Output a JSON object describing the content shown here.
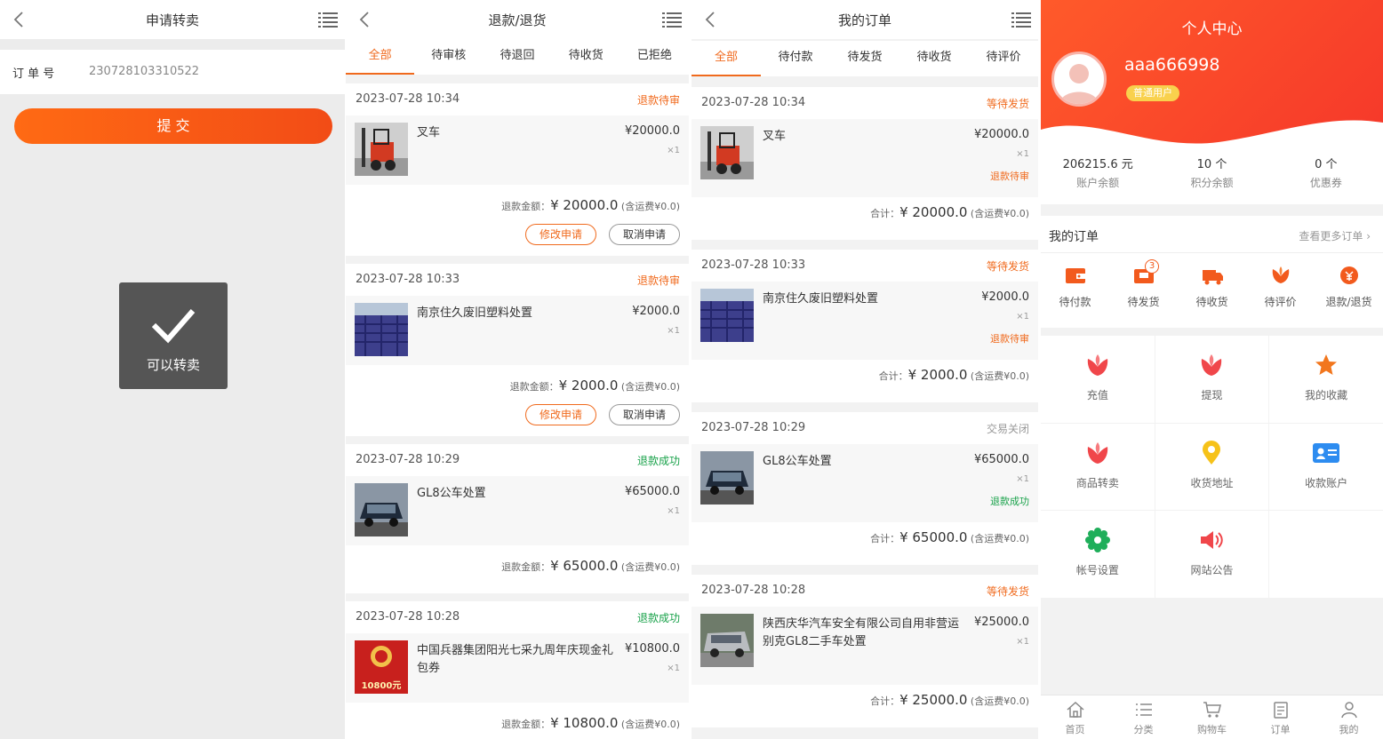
{
  "p1": {
    "title": "申请转卖",
    "order_label": "订 单 号",
    "order_no": "230728103310522",
    "submit": "提 交",
    "toast": "可以转卖"
  },
  "p2": {
    "title": "退款/退货",
    "tabs": [
      "全部",
      "待审核",
      "待退回",
      "待收货",
      "已拒绝"
    ],
    "cards": [
      {
        "date": "2023-07-28 10:34",
        "status": "退款待审",
        "name": "叉车",
        "price": "¥20000.0",
        "qty": "×1",
        "sum_label": "退款金额：",
        "sum": "¥ 20000.0",
        "freight": "(含运费¥0.0)",
        "btn1": "修改申请",
        "btn2": "取消申请"
      },
      {
        "date": "2023-07-28 10:33",
        "status": "退款待审",
        "name": "南京住久废旧塑料处置",
        "price": "¥2000.0",
        "qty": "×1",
        "sum_label": "退款金额：",
        "sum": "¥ 2000.0",
        "freight": "(含运费¥0.0)",
        "btn1": "修改申请",
        "btn2": "取消申请"
      },
      {
        "date": "2023-07-28 10:29",
        "status": "退款成功",
        "name": "GL8公车处置",
        "price": "¥65000.0",
        "qty": "×1",
        "sum_label": "退款金额：",
        "sum": "¥ 65000.0",
        "freight": "(含运费¥0.0)"
      },
      {
        "date": "2023-07-28 10:28",
        "status": "退款成功",
        "name": "中国兵器集团阳光七采九周年庆现金礼包券",
        "price": "¥10800.0",
        "qty": "×1",
        "sum_label": "退款金额：",
        "sum": "¥ 10800.0",
        "freight": "(含运费¥0.0)",
        "thumb_text": "10800元"
      }
    ]
  },
  "p3": {
    "title": "我的订单",
    "tabs": [
      "全部",
      "待付款",
      "待发货",
      "待收货",
      "待评价"
    ],
    "cards": [
      {
        "date": "2023-07-28 10:34",
        "status": "等待发货",
        "name": "叉车",
        "price": "¥20000.0",
        "qty": "×1",
        "sub": "退款待审",
        "sum_label": "合计：",
        "sum": "¥ 20000.0",
        "freight": "(含运费¥0.0)"
      },
      {
        "date": "2023-07-28 10:33",
        "status": "等待发货",
        "name": "南京住久废旧塑料处置",
        "price": "¥2000.0",
        "qty": "×1",
        "sub": "退款待审",
        "sum_label": "合计：",
        "sum": "¥ 2000.0",
        "freight": "(含运费¥0.0)"
      },
      {
        "date": "2023-07-28 10:29",
        "status": "交易关闭",
        "name": "GL8公车处置",
        "price": "¥65000.0",
        "qty": "×1",
        "sub": "退款成功",
        "sum_label": "合计：",
        "sum": "¥ 65000.0",
        "freight": "(含运费¥0.0)"
      },
      {
        "date": "2023-07-28 10:28",
        "status": "等待发货",
        "name": "陕西庆华汽车安全有限公司自用非营运别克GL8二手车处置",
        "price": "¥25000.0",
        "qty": "×1",
        "sum_label": "合计：",
        "sum": "¥ 25000.0",
        "freight": "(含运费¥0.0)"
      }
    ]
  },
  "p4": {
    "title": "个人中心",
    "username": "aaa666998",
    "user_badge": "普通用户",
    "stats": [
      {
        "value": "206215.6 元",
        "label": "账户余额"
      },
      {
        "value": "10 个",
        "label": "积分余额"
      },
      {
        "value": "0 个",
        "label": "优惠券"
      }
    ],
    "orders_title": "我的订单",
    "orders_more": "查看更多订单",
    "order_icons": [
      {
        "label": "待付款",
        "icon": "wallet-icon"
      },
      {
        "label": "待发货",
        "icon": "box-icon",
        "badge": "3"
      },
      {
        "label": "待收货",
        "icon": "truck-icon"
      },
      {
        "label": "待评价",
        "icon": "flower-icon"
      },
      {
        "label": "退款/退货",
        "icon": "refund-icon"
      }
    ],
    "grid": [
      {
        "label": "充值",
        "icon": "lotus-icon"
      },
      {
        "label": "提现",
        "icon": "lotus-icon"
      },
      {
        "label": "我的收藏",
        "icon": "star-icon"
      },
      {
        "label": "商品转卖",
        "icon": "lotus-icon"
      },
      {
        "label": "收货地址",
        "icon": "location-icon"
      },
      {
        "label": "收款账户",
        "icon": "id-card-icon"
      },
      {
        "label": "帐号设置",
        "icon": "gear-icon"
      },
      {
        "label": "网站公告",
        "icon": "megaphone-icon"
      }
    ],
    "tabbar": [
      "首页",
      "分类",
      "购物车",
      "订单",
      "我的"
    ],
    "colors": {
      "accent": "#f06a1d",
      "header": "#f5402a",
      "success": "#19a24a"
    }
  }
}
